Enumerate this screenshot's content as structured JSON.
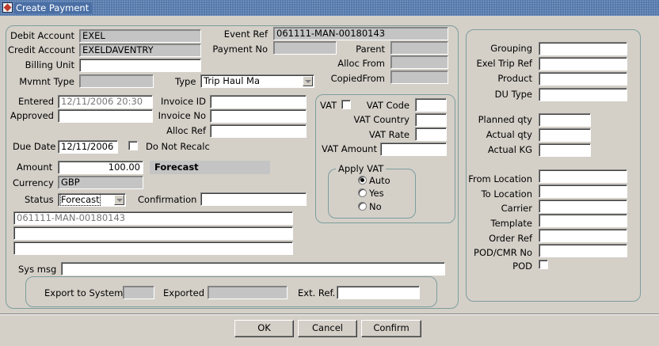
{
  "window": {
    "title": "Create Payment",
    "icon": "app-window-icon"
  },
  "left": {
    "debit_account_label": "Debit Account",
    "debit_account_value": "EXEL",
    "credit_account_label": "Credit Account",
    "credit_account_value": "EXELDAVENTRY",
    "billing_unit_label": "Billing Unit",
    "billing_unit_value": "",
    "mvmnt_type_label": "Mvmnt Type",
    "mvmnt_type_value": "",
    "type_label": "Type",
    "type_value": "Trip Haul Ma",
    "event_ref_label": "Event Ref",
    "event_ref_value": "061111-MAN-00180143",
    "payment_no_label": "Payment No",
    "payment_no_value": "",
    "parent_label": "Parent",
    "parent_value": "",
    "alloc_from_label": "Alloc From",
    "alloc_from_value": "",
    "copied_from_label": "CopiedFrom",
    "copied_from_value": "",
    "entered_label": "Entered",
    "entered_value": "12/11/2006 20:30",
    "approved_label": "Approved",
    "approved_value": "",
    "invoice_id_label": "Invoice ID",
    "invoice_id_value": "",
    "invoice_no_label": "Invoice No",
    "invoice_no_value": "",
    "alloc_ref_label": "Alloc Ref",
    "alloc_ref_value": "",
    "due_date_label": "Due Date",
    "due_date_value": "12/11/2006",
    "do_not_recalc_label": "Do Not Recalc",
    "amount_label": "Amount",
    "amount_value": "100.00",
    "forecast_badge": "Forecast",
    "currency_label": "Currency",
    "currency_value": "GBP",
    "status_label": "Status",
    "status_value": "Forecast",
    "confirmation_label": "Confirmation",
    "confirmation_value": "",
    "note_line_1": "061111-MAN-00180143",
    "note_line_2": "",
    "note_line_3": "",
    "sys_msg_label": "Sys msg",
    "sys_msg_value": ""
  },
  "vat": {
    "vat_label": "VAT",
    "vat_code_label": "VAT Code",
    "vat_code_value": "",
    "vat_country_label": "VAT Country",
    "vat_country_value": "",
    "vat_rate_label": "VAT Rate",
    "vat_rate_value": "",
    "vat_amount_label": "VAT Amount",
    "vat_amount_value": "",
    "apply_vat_label": "Apply VAT",
    "options": [
      "Auto",
      "Yes",
      "No"
    ],
    "selected": "Auto"
  },
  "export": {
    "export_to_system_label": "Export to System",
    "export_to_system_value": "",
    "exported_label": "Exported",
    "exported_value": "",
    "ext_ref_label": "Ext. Ref.",
    "ext_ref_value": ""
  },
  "right": {
    "grouping_label": "Grouping",
    "exel_trip_ref_label": "Exel Trip Ref",
    "product_label": "Product",
    "du_type_label": "DU Type",
    "planned_qty_label": "Planned qty",
    "actual_qty_label": "Actual qty",
    "actual_kg_label": "Actual KG",
    "from_location_label": "From Location",
    "to_location_label": "To Location",
    "carrier_label": "Carrier",
    "template_label": "Template",
    "order_ref_label": "Order Ref",
    "pod_cmr_no_label": "POD/CMR No",
    "pod_label": "POD"
  },
  "buttons": {
    "ok": "OK",
    "cancel": "Cancel",
    "confirm": "Confirm"
  }
}
